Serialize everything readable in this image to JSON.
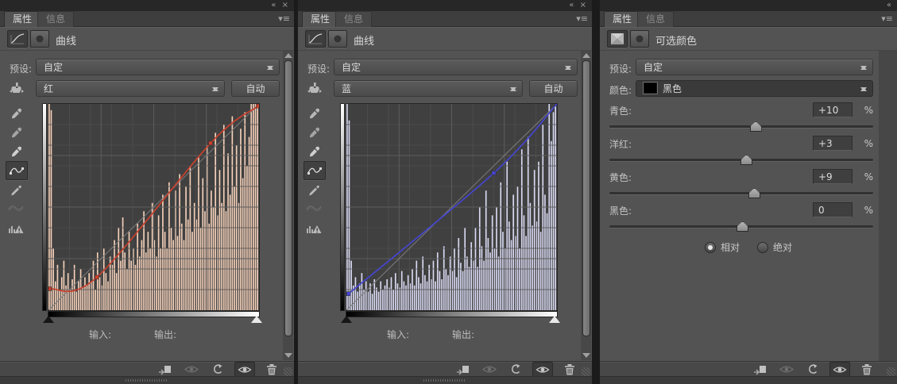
{
  "tabs": {
    "properties": "属性",
    "info": "信息"
  },
  "common": {
    "preset_label": "预设:",
    "preset_value": "自定",
    "auto_label": "自动",
    "input_label": "输入:",
    "output_label": "输出:",
    "percent": "%",
    "collapse_glyph": "«",
    "close_glyph": "×",
    "menu_glyph": "▾≡"
  },
  "panels": {
    "curves_red": {
      "title": "曲线",
      "channel": "红",
      "curve_color": "#c9412e",
      "histogram_color": "#f6d2bb",
      "curve_points": [
        [
          0.004,
          0.104
        ],
        [
          0.23,
          0.16
        ],
        [
          0.77,
          0.81
        ],
        [
          0.996,
          0.99
        ]
      ],
      "histogram": [
        100,
        97,
        30,
        14,
        22,
        10,
        16,
        24,
        12,
        18,
        10,
        15,
        22,
        9,
        14,
        20,
        11,
        16,
        12,
        18,
        14,
        24,
        10,
        28,
        16,
        12,
        30,
        18,
        14,
        26,
        22,
        34,
        18,
        40,
        24,
        45,
        28,
        20,
        38,
        24,
        30,
        22,
        42,
        26,
        34,
        48,
        28,
        38,
        30,
        52,
        34,
        26,
        46,
        30,
        56,
        38,
        30,
        62,
        40,
        34,
        58,
        36,
        66,
        42,
        34,
        60,
        44,
        70,
        38,
        52,
        44,
        74,
        40,
        64,
        48,
        80,
        42,
        58,
        50,
        86,
        46,
        68,
        52,
        90,
        48,
        76,
        56,
        94,
        60,
        80,
        52,
        88,
        64,
        96,
        70,
        84,
        100,
        100,
        100,
        100
      ]
    },
    "curves_blue": {
      "title": "曲线",
      "channel": "蓝",
      "curve_color": "#4545cf",
      "histogram_color": "#dadbf4",
      "curve_points": [
        [
          0.01,
          0.08
        ],
        [
          0.7,
          0.665
        ],
        [
          1,
          1
        ]
      ],
      "histogram": [
        100,
        92,
        24,
        12,
        16,
        9,
        13,
        18,
        10,
        14,
        9,
        13,
        8,
        15,
        11,
        9,
        14,
        10,
        12,
        15,
        11,
        16,
        10,
        18,
        13,
        11,
        19,
        14,
        12,
        17,
        13,
        20,
        12,
        24,
        16,
        13,
        26,
        17,
        14,
        22,
        15,
        24,
        14,
        28,
        19,
        15,
        31,
        20,
        17,
        26,
        19,
        30,
        16,
        35,
        23,
        19,
        40,
        26,
        21,
        33,
        24,
        40,
        21,
        50,
        31,
        24,
        58,
        35,
        28,
        46,
        30,
        50,
        26,
        62,
        38,
        30,
        72,
        43,
        34,
        56,
        36,
        60,
        30,
        78,
        46,
        36,
        84,
        52,
        41,
        68,
        43,
        72,
        38,
        90,
        56,
        47,
        100,
        82,
        96,
        100
      ]
    },
    "selective_color": {
      "title": "可选颜色",
      "color_label": "颜色:",
      "color_value": "黑色",
      "color_swatch": "#000000",
      "sliders": [
        {
          "label": "青色:",
          "value": "+10",
          "num": 10
        },
        {
          "label": "洋红:",
          "value": "+3",
          "num": 3
        },
        {
          "label": "黄色:",
          "value": "+9",
          "num": 9
        },
        {
          "label": "黑色:",
          "value": "0",
          "num": 0
        }
      ],
      "radios": [
        {
          "label": "相对",
          "selected": true
        },
        {
          "label": "绝对",
          "selected": false
        }
      ]
    }
  }
}
